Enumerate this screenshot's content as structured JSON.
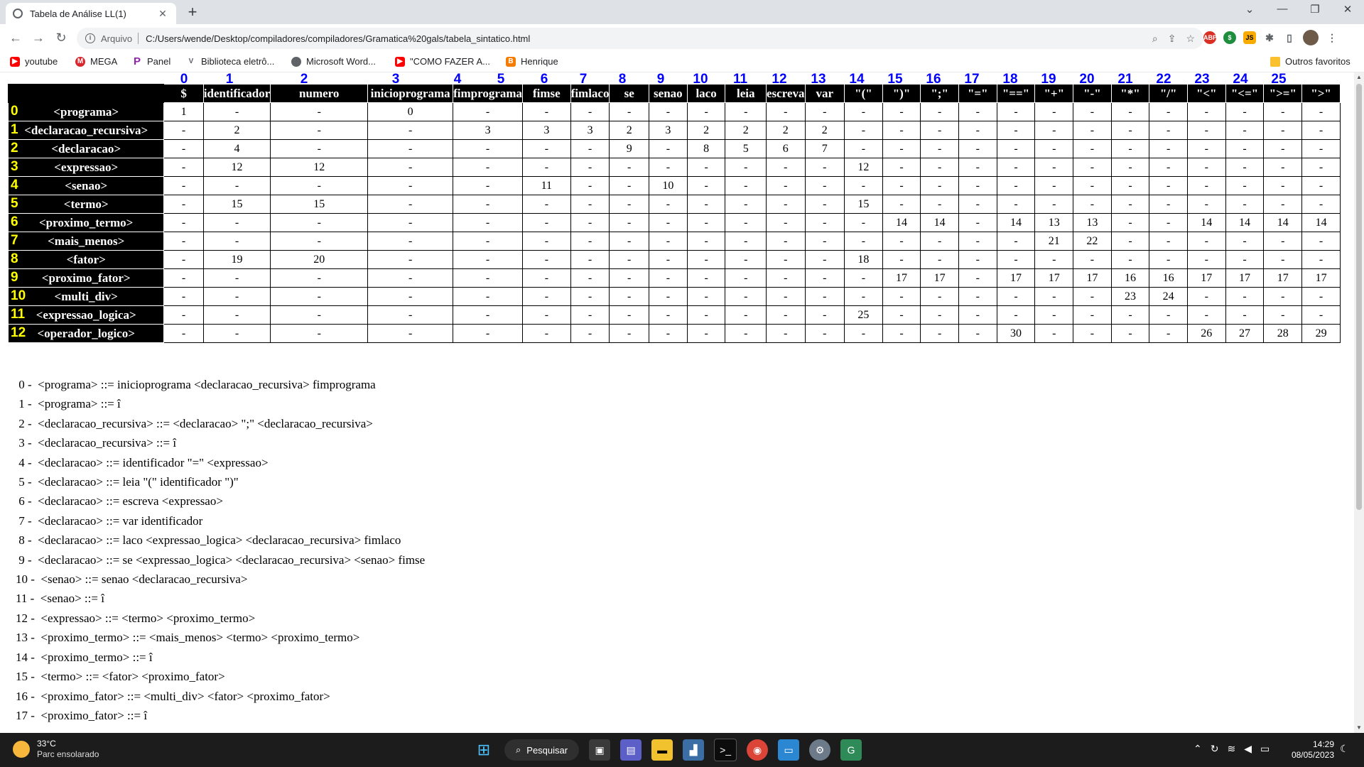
{
  "browser": {
    "tab_title": "Tabela de Análise LL(1)",
    "tab_close": "✕",
    "new_tab": "+",
    "url_scheme": "Arquivo",
    "url": "C:/Users/wende/Desktop/compiladores/compiladores/Gramatica%20gals/tabela_sintatico.html",
    "bookmarks": [
      "youtube",
      "MEGA",
      "Panel",
      "Biblioteca eletrô...",
      "Microsoft Word...",
      "\"COMO FAZER A...",
      "Henrique"
    ],
    "other_bookmarks": "Outros favoritos",
    "colors": {
      "tabstrip": "#dee1e6",
      "omnibox": "#f1f3f4"
    }
  },
  "table": {
    "column_numbers": [
      "0",
      "1",
      "2",
      "3",
      "4",
      "5",
      "6",
      "7",
      "8",
      "9",
      "10",
      "11",
      "12",
      "13",
      "14",
      "15",
      "16",
      "17",
      "18",
      "19",
      "20",
      "21",
      "22",
      "23",
      "24",
      "25"
    ],
    "headers": [
      "$",
      "identificador",
      "numero",
      "inicioprograma",
      "fimprograma",
      "fimse",
      "fimlaco",
      "se",
      "senao",
      "laco",
      "leia",
      "escreva",
      "var",
      "\"(\"",
      "\")\"",
      "\";\"",
      "\"=\"",
      "\"==\"",
      "\"+\"",
      "\"-\"",
      "\"*\"",
      "\"/\"",
      "\"<\"",
      "\"<=\"",
      "\">=\"",
      "\">\""
    ],
    "rows": [
      {
        "num": "0",
        "label": "<programa>",
        "cells": [
          "1",
          "-",
          "-",
          "0",
          "-",
          "-",
          "-",
          "-",
          "-",
          "-",
          "-",
          "-",
          "-",
          "-",
          "-",
          "-",
          "-",
          "-",
          "-",
          "-",
          "-",
          "-",
          "-",
          "-",
          "-",
          "-"
        ]
      },
      {
        "num": "1",
        "label": "<declaracao_recursiva>",
        "cells": [
          "-",
          "2",
          "-",
          "-",
          "3",
          "3",
          "3",
          "2",
          "3",
          "2",
          "2",
          "2",
          "2",
          "-",
          "-",
          "-",
          "-",
          "-",
          "-",
          "-",
          "-",
          "-",
          "-",
          "-",
          "-",
          "-"
        ]
      },
      {
        "num": "2",
        "label": "<declaracao>",
        "cells": [
          "-",
          "4",
          "-",
          "-",
          "-",
          "-",
          "-",
          "9",
          "-",
          "8",
          "5",
          "6",
          "7",
          "-",
          "-",
          "-",
          "-",
          "-",
          "-",
          "-",
          "-",
          "-",
          "-",
          "-",
          "-",
          "-"
        ]
      },
      {
        "num": "3",
        "label": "<expressao>",
        "cells": [
          "-",
          "12",
          "12",
          "-",
          "-",
          "-",
          "-",
          "-",
          "-",
          "-",
          "-",
          "-",
          "-",
          "12",
          "-",
          "-",
          "-",
          "-",
          "-",
          "-",
          "-",
          "-",
          "-",
          "-",
          "-",
          "-"
        ]
      },
      {
        "num": "4",
        "label": "<senao>",
        "cells": [
          "-",
          "-",
          "-",
          "-",
          "-",
          "11",
          "-",
          "-",
          "10",
          "-",
          "-",
          "-",
          "-",
          "-",
          "-",
          "-",
          "-",
          "-",
          "-",
          "-",
          "-",
          "-",
          "-",
          "-",
          "-",
          "-"
        ]
      },
      {
        "num": "5",
        "label": "<termo>",
        "cells": [
          "-",
          "15",
          "15",
          "-",
          "-",
          "-",
          "-",
          "-",
          "-",
          "-",
          "-",
          "-",
          "-",
          "15",
          "-",
          "-",
          "-",
          "-",
          "-",
          "-",
          "-",
          "-",
          "-",
          "-",
          "-",
          "-"
        ]
      },
      {
        "num": "6",
        "label": "<proximo_termo>",
        "cells": [
          "-",
          "-",
          "-",
          "-",
          "-",
          "-",
          "-",
          "-",
          "-",
          "-",
          "-",
          "-",
          "-",
          "-",
          "14",
          "14",
          "-",
          "14",
          "13",
          "13",
          "-",
          "-",
          "14",
          "14",
          "14",
          "14"
        ]
      },
      {
        "num": "7",
        "label": "<mais_menos>",
        "cells": [
          "-",
          "-",
          "-",
          "-",
          "-",
          "-",
          "-",
          "-",
          "-",
          "-",
          "-",
          "-",
          "-",
          "-",
          "-",
          "-",
          "-",
          "-",
          "21",
          "22",
          "-",
          "-",
          "-",
          "-",
          "-",
          "-"
        ]
      },
      {
        "num": "8",
        "label": "<fator>",
        "cells": [
          "-",
          "19",
          "20",
          "-",
          "-",
          "-",
          "-",
          "-",
          "-",
          "-",
          "-",
          "-",
          "-",
          "18",
          "-",
          "-",
          "-",
          "-",
          "-",
          "-",
          "-",
          "-",
          "-",
          "-",
          "-",
          "-"
        ]
      },
      {
        "num": "9",
        "label": "<proximo_fator>",
        "cells": [
          "-",
          "-",
          "-",
          "-",
          "-",
          "-",
          "-",
          "-",
          "-",
          "-",
          "-",
          "-",
          "-",
          "-",
          "17",
          "17",
          "-",
          "17",
          "17",
          "17",
          "16",
          "16",
          "17",
          "17",
          "17",
          "17"
        ]
      },
      {
        "num": "10",
        "label": "<multi_div>",
        "cells": [
          "-",
          "-",
          "-",
          "-",
          "-",
          "-",
          "-",
          "-",
          "-",
          "-",
          "-",
          "-",
          "-",
          "-",
          "-",
          "-",
          "-",
          "-",
          "-",
          "-",
          "23",
          "24",
          "-",
          "-",
          "-",
          "-"
        ]
      },
      {
        "num": "11",
        "label": "<expressao_logica>",
        "cells": [
          "-",
          "-",
          "-",
          "-",
          "-",
          "-",
          "-",
          "-",
          "-",
          "-",
          "-",
          "-",
          "-",
          "25",
          "-",
          "-",
          "-",
          "-",
          "-",
          "-",
          "-",
          "-",
          "-",
          "-",
          "-",
          "-"
        ]
      },
      {
        "num": "12",
        "label": "<operador_logico>",
        "cells": [
          "-",
          "-",
          "-",
          "-",
          "-",
          "-",
          "-",
          "-",
          "-",
          "-",
          "-",
          "-",
          "-",
          "-",
          "-",
          "-",
          "-",
          "30",
          "-",
          "-",
          "-",
          "-",
          "26",
          "27",
          "28",
          "29"
        ]
      }
    ]
  },
  "rules": [
    " 0 -  <programa> ::= inicioprograma <declaracao_recursiva> fimprograma",
    " 1 -  <programa> ::= î",
    " 2 -  <declaracao_recursiva> ::= <declaracao> \";\" <declaracao_recursiva>",
    " 3 -  <declaracao_recursiva> ::= î",
    " 4 -  <declaracao> ::= identificador \"=\" <expressao>",
    " 5 -  <declaracao> ::= leia \"(\" identificador \")\"",
    " 6 -  <declaracao> ::= escreva <expressao>",
    " 7 -  <declaracao> ::= var identificador",
    " 8 -  <declaracao> ::= laco <expressao_logica> <declaracao_recursiva> fimlaco",
    " 9 -  <declaracao> ::= se <expressao_logica> <declaracao_recursiva> <senao> fimse",
    "10 -  <senao> ::= senao <declaracao_recursiva>",
    "11 -  <senao> ::= î",
    "12 -  <expressao> ::= <termo> <proximo_termo>",
    "13 -  <proximo_termo> ::= <mais_menos> <termo> <proximo_termo>",
    "14 -  <proximo_termo> ::= î",
    "15 -  <termo> ::= <fator> <proximo_fator>",
    "16 -  <proximo_fator> ::= <multi_div> <fator> <proximo_fator>",
    "17 -  <proximo_fator> ::= î"
  ],
  "taskbar": {
    "temperature": "33°C",
    "weather": "Parc ensolarado",
    "search_label": "Pesquisar",
    "time": "14:29",
    "date": "08/05/2023"
  }
}
